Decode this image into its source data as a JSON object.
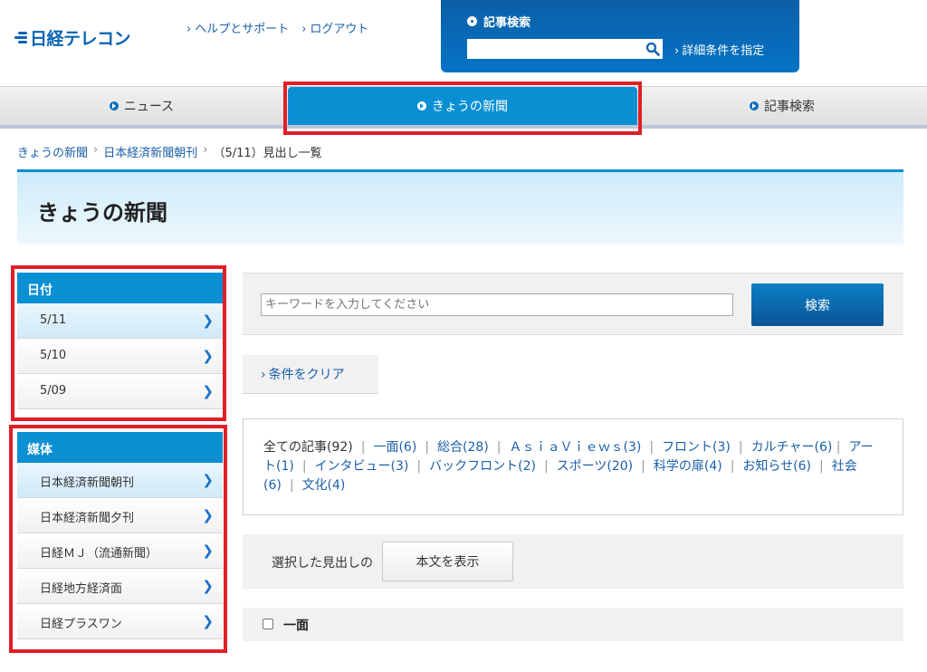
{
  "header": {
    "logo_text": "日経テレコン",
    "links": [
      "ヘルプとサポート",
      "ログアウト"
    ],
    "search": {
      "title": "記事検索",
      "detail_link": "詳細条件を指定"
    }
  },
  "nav": {
    "tabs": [
      {
        "label": "ニュース"
      },
      {
        "label": "きょうの新聞"
      },
      {
        "label": "記事検索"
      }
    ]
  },
  "breadcrumb": {
    "items": [
      "きょうの新聞",
      "日本経済新聞朝刊",
      "（5/11）見出し一覧"
    ]
  },
  "page_title": "きょうの新聞",
  "sidebar": {
    "date_group": {
      "title": "日付",
      "items": [
        "5/11",
        "5/10",
        "5/09"
      ]
    },
    "media_group": {
      "title": "媒体",
      "items": [
        "日本経済新聞朝刊",
        "日本経済新聞夕刊",
        "日経ＭＪ（流通新聞）",
        "日経地方経済面",
        "日経プラスワン"
      ]
    }
  },
  "keyword": {
    "placeholder": "キーワードを入力してください",
    "search_button": "検索"
  },
  "clear_label": "条件をクリア",
  "categories": [
    "全ての記事(92)",
    "一面(6)",
    "総合(28)",
    "ＡｓｉａＶｉｅｗｓ(3)",
    "フロント(3)",
    "カルチャー(6)",
    "アート(1)",
    "インタビュー(3)",
    "バックフロント(2)",
    "スポーツ(20)",
    "科学の扉(4)",
    "お知らせ(6)",
    "社会(6)",
    "文化(4)"
  ],
  "selection": {
    "label": "選択した見出しの",
    "button": "本文を表示"
  },
  "section": {
    "label": "一面"
  },
  "colors": {
    "accent": "#0a8fd3",
    "highlight_red": "#e21e26",
    "link": "#1b5fa8"
  }
}
